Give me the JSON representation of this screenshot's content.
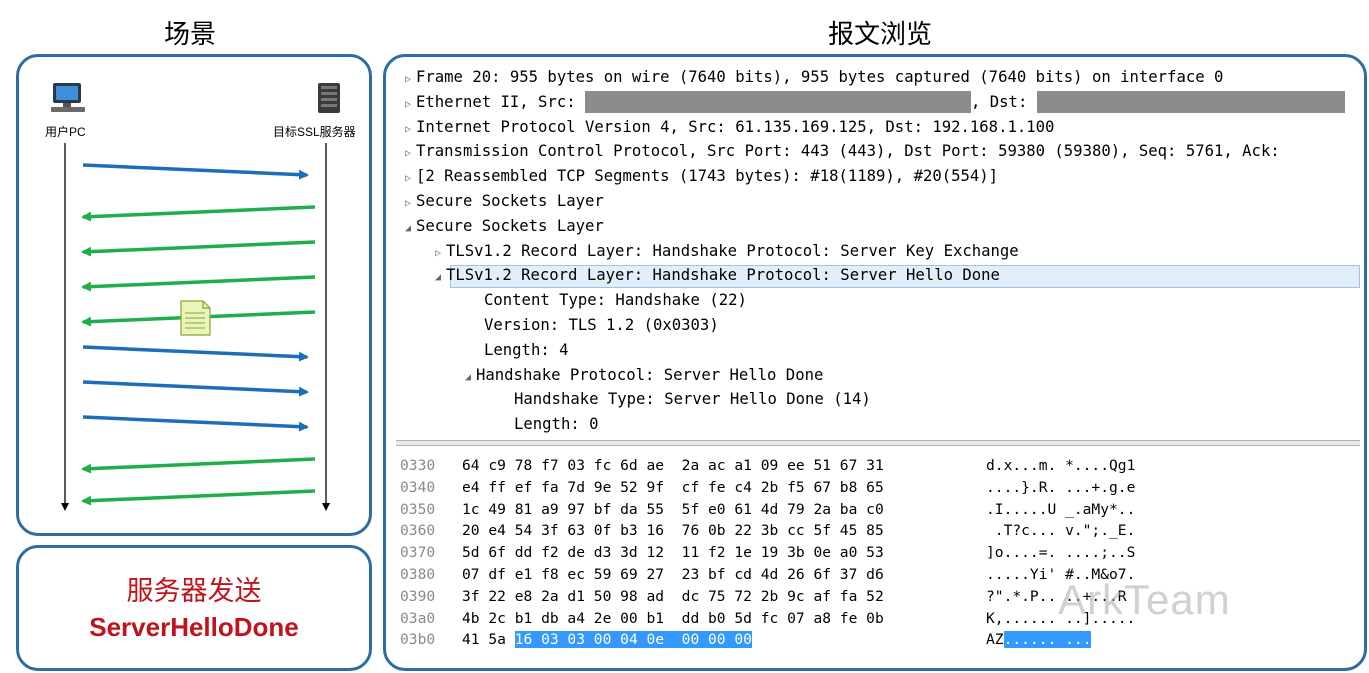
{
  "titles": {
    "scene": "场景",
    "packet": "报文浏览"
  },
  "scene": {
    "client_label": "用户PC",
    "server_label": "目标SSL服务器",
    "colors": {
      "to_server": "#1d6db7",
      "to_client": "#1fae4b"
    }
  },
  "caption": {
    "line1": "服务器发送",
    "line2": "ServerHelloDone"
  },
  "tree": [
    {
      "text": "Frame 20: 955 bytes on wire (7640 bits), 955 bytes captured (7640 bits) on interface 0"
    },
    {
      "text_a": "Ethernet II, Src: ",
      "text_b": ", Dst:"
    },
    {
      "text": "Internet Protocol Version 4, Src: 61.135.169.125, Dst: 192.168.1.100"
    },
    {
      "text": "Transmission Control Protocol, Src Port: 443 (443), Dst Port: 59380 (59380), Seq: 5761, Ack:"
    },
    {
      "text": "[2 Reassembled TCP Segments (1743 bytes): #18(1189), #20(554)]"
    },
    {
      "text": "Secure Sockets Layer"
    },
    {
      "text": "Secure Sockets Layer"
    },
    {
      "text": "TLSv1.2 Record Layer: Handshake Protocol: Server Key Exchange"
    },
    {
      "text": "TLSv1.2 Record Layer: Handshake Protocol: Server Hello Done"
    },
    {
      "text": "Content Type: Handshake (22)"
    },
    {
      "text": "Version: TLS 1.2 (0x0303)"
    },
    {
      "text": "Length: 4"
    },
    {
      "text": "Handshake Protocol: Server Hello Done"
    },
    {
      "text": "Handshake Type: Server Hello Done (14)"
    },
    {
      "text": "Length: 0"
    }
  ],
  "hex_rows": [
    {
      "offset": "0330",
      "bytes": "64 c9 78 f7 03 fc 6d ae  2a ac a1 09 ee 51 67 31",
      "ascii": "d.x...m. *....Qg1"
    },
    {
      "offset": "0340",
      "bytes": "e4 ff ef fa 7d 9e 52 9f  cf fe c4 2b f5 67 b8 65",
      "ascii": "....}.R. ...+.g.e"
    },
    {
      "offset": "0350",
      "bytes": "1c 49 81 a9 97 bf da 55  5f e0 61 4d 79 2a ba c0",
      "ascii": ".I.....U _.aMy*.."
    },
    {
      "offset": "0360",
      "bytes": "20 e4 54 3f 63 0f b3 16  76 0b 22 3b cc 5f 45 85",
      "ascii": " .T?c... v.\";._E."
    },
    {
      "offset": "0370",
      "bytes": "5d 6f dd f2 de d3 3d 12  11 f2 1e 19 3b 0e a0 53",
      "ascii": "]o....=. ....;..S"
    },
    {
      "offset": "0380",
      "bytes": "07 df e1 f8 ec 59 69 27  23 bf cd 4d 26 6f 37 d6",
      "ascii": ".....Yi' #..M&o7."
    },
    {
      "offset": "0390",
      "bytes": "3f 22 e8 2a d1 50 98 ad  dc 75 72 2b 9c af fa 52",
      "ascii": "?\".*.P.. ..+...R"
    },
    {
      "offset": "03a0",
      "bytes": "4b 2c b1 db a4 2e 00 b1  dd b0 5d fc 07 a8 fe 0b",
      "ascii": "K,...... ..]....."
    },
    {
      "offset": "03b0",
      "bytes_plain": "41 5a ",
      "bytes_sel": "16 03 03 00 04 0e  00 00 00",
      "ascii_plain": "AZ",
      "ascii_sel": "...... ..."
    }
  ],
  "watermark": "ArkTeam"
}
